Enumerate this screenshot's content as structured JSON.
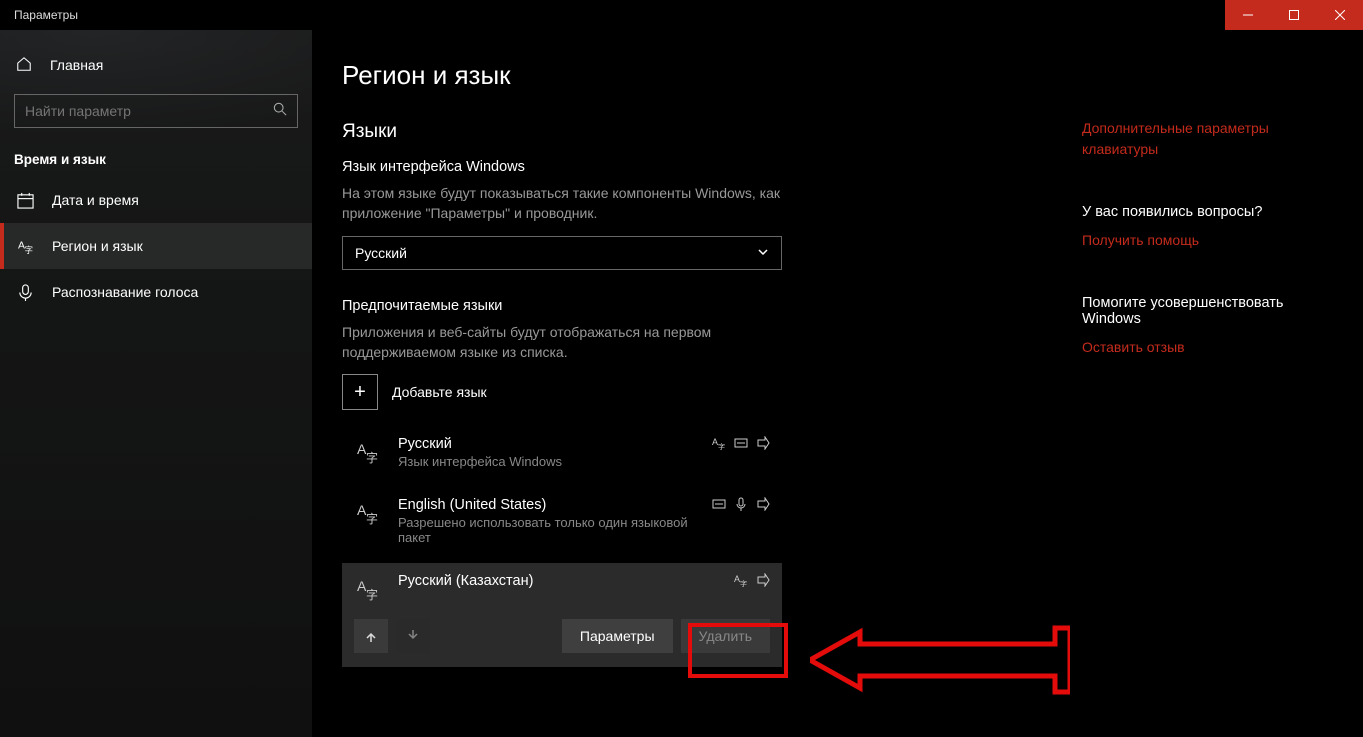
{
  "window": {
    "title": "Параметры"
  },
  "sidebar": {
    "home_label": "Главная",
    "search_placeholder": "Найти параметр",
    "section_title": "Время и язык",
    "items": [
      {
        "label": "Дата и время"
      },
      {
        "label": "Регион и язык"
      },
      {
        "label": "Распознавание голоса"
      }
    ]
  },
  "main": {
    "page_title": "Регион и язык",
    "languages_section": "Языки",
    "interface_lang_title": "Язык интерфейса Windows",
    "interface_lang_desc": "На этом языке будут показываться такие компоненты Windows, как приложение \"Параметры\" и проводник.",
    "dropdown_value": "Русский",
    "preferred_title": "Предпочитаемые языки",
    "preferred_desc": "Приложения и веб-сайты будут отображаться на первом поддерживаемом языке из списка.",
    "add_language_label": "Добавьте язык",
    "languages": [
      {
        "name": "Русский",
        "sub": "Язык интерфейса Windows"
      },
      {
        "name": "English (United States)",
        "sub": "Разрешено использовать только один языковой пакет"
      },
      {
        "name": "Русский (Казахстан)",
        "sub": ""
      }
    ],
    "actions": {
      "params": "Параметры",
      "delete": "Удалить"
    }
  },
  "aside": {
    "rel1_link": "Дополнительные параметры клавиатуры",
    "q_title": "У вас появились вопросы?",
    "q_link": "Получить помощь",
    "fb_title": "Помогите усовершенствовать Windows",
    "fb_link": "Оставить отзыв"
  }
}
